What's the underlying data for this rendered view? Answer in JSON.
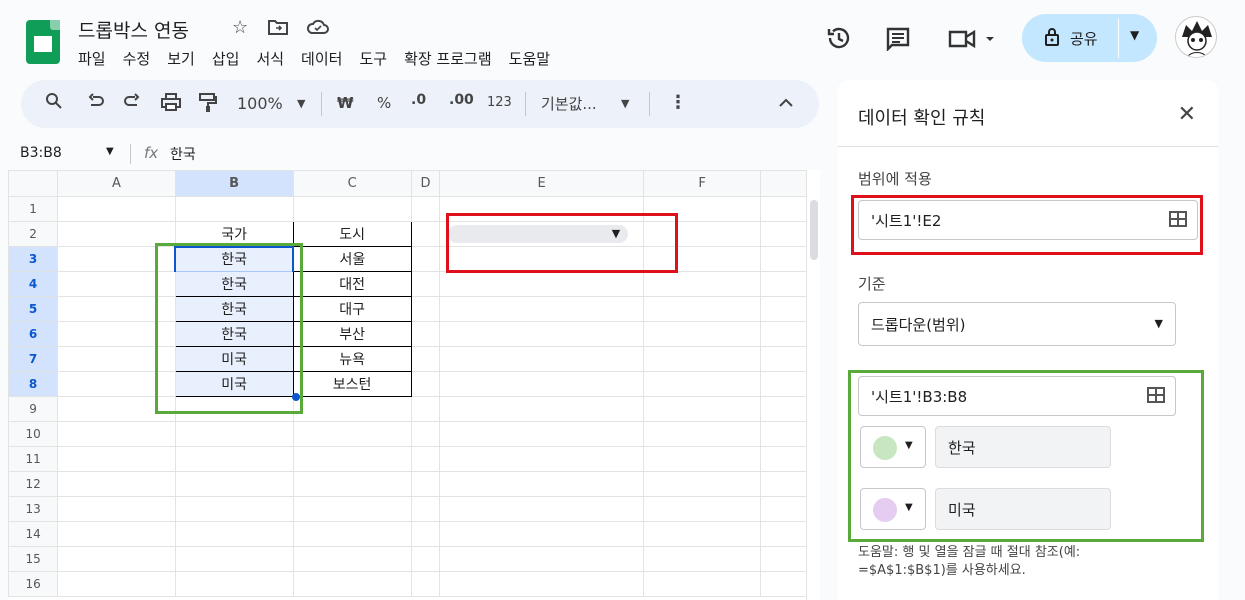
{
  "header": {
    "doc_title": "드롭박스 연동",
    "menu": [
      "파일",
      "수정",
      "보기",
      "삽입",
      "서식",
      "데이터",
      "도구",
      "확장 프로그램",
      "도움말"
    ],
    "share_label": "공유"
  },
  "toolbar": {
    "zoom": "100%",
    "currency": "₩",
    "percent": "%",
    "dec_decrease": ".0",
    "dec_increase": ".00",
    "number_format": "123",
    "font": "기본값..."
  },
  "formula_bar": {
    "name_box": "B3:B8",
    "fx": "fx",
    "value": "한국"
  },
  "sheet": {
    "columns": [
      "A",
      "B",
      "C",
      "D",
      "E",
      "F"
    ],
    "rows": [
      "1",
      "2",
      "3",
      "4",
      "5",
      "6",
      "7",
      "8",
      "9",
      "10",
      "11",
      "12",
      "13",
      "14",
      "15",
      "16"
    ],
    "b_values": [
      "국가",
      "한국",
      "한국",
      "한국",
      "한국",
      "미국",
      "미국"
    ],
    "c_values": [
      "도시",
      "서울",
      "대전",
      "대구",
      "부산",
      "뉴욕",
      "보스턴"
    ]
  },
  "panel": {
    "title": "데이터 확인 규칙",
    "range_label": "범위에 적용",
    "range_value": "'시트1'!E2",
    "criteria_label": "기준",
    "criteria_value": "드롭다운(범위)",
    "source_range": "'시트1'!B3:B8",
    "items": [
      {
        "value": "한국",
        "color": "#c8e6c0"
      },
      {
        "value": "미국",
        "color": "#e4cdf0"
      }
    ],
    "help_line1": "도움말: 행 및 열을 잠글 때 절대 참조(예:",
    "help_line2": "=$A$1:$B$1)를 사용하세요."
  },
  "colors": {
    "accent": "#0b57d0",
    "share_bg": "#c2e7ff",
    "red_box": "#e0101a",
    "green_box": "#5aa93b"
  }
}
